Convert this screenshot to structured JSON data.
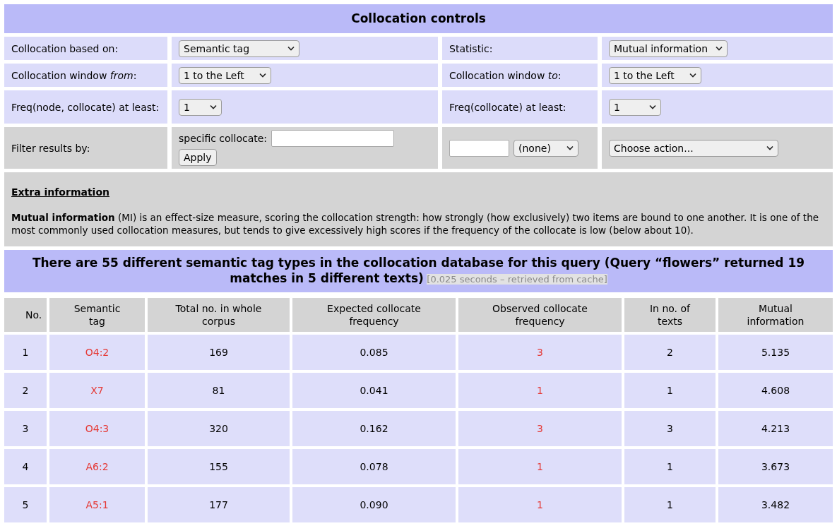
{
  "controls": {
    "title": "Collocation controls",
    "rows": [
      {
        "kind": "setting",
        "cells": [
          {
            "kind": "label",
            "text": "Collocation based on:"
          },
          {
            "kind": "select",
            "value": "Semantic tag"
          },
          {
            "kind": "label",
            "text": "Statistic:"
          },
          {
            "kind": "select",
            "value": "Mutual information"
          }
        ]
      },
      {
        "kind": "setting",
        "cells": [
          {
            "kind": "label",
            "text": "Collocation window *from*:"
          },
          {
            "kind": "select",
            "value": "1 to the Left"
          },
          {
            "kind": "label",
            "text": "Collocation window *to*:"
          },
          {
            "kind": "select",
            "value": "1 to the Left"
          }
        ]
      },
      {
        "kind": "setting",
        "cells": [
          {
            "kind": "label",
            "text": "Freq(node, collocate) at least:"
          },
          {
            "kind": "select",
            "value": "1"
          },
          {
            "kind": "label",
            "text": "Freq(collocate) at least:"
          },
          {
            "kind": "select",
            "value": "1"
          }
        ]
      },
      {
        "kind": "filter",
        "cells": [
          {
            "kind": "label",
            "text": "Filter results by:"
          },
          {
            "kind": "collocate",
            "label": "specific collocate:",
            "button": "Apply"
          },
          {
            "kind": "input_select",
            "value": "(none)"
          },
          {
            "kind": "select",
            "value": "Choose action..."
          }
        ]
      }
    ]
  },
  "extra": {
    "heading": "Extra information",
    "text": "**Mutual information** (MI) is an effect-size measure, scoring the collocation strength: how strongly (how exclusively) two items are bound to one another. It is one of the most commonly used collocation measures, but tends to give excessively high scores if the frequency of the collocate is low (below about 10)."
  },
  "results": {
    "title": "There are 55 different semantic tag types in the collocation database for this query (Query “flowers” returned 19 matches in 5 different texts)",
    "note": "[0.025 seconds – retrieved from cache]",
    "columns": [
      {
        "label": "No.",
        "kind": "plain"
      },
      {
        "label": "Semantic tag",
        "kind": "link"
      },
      {
        "label": "Total no. in whole corpus",
        "kind": "plain"
      },
      {
        "label": "Expected collocate frequency",
        "kind": "plain"
      },
      {
        "label": "Observed collocate frequency",
        "kind": "link"
      },
      {
        "label": "In no. of texts",
        "kind": "plain"
      },
      {
        "label": "Mutual information",
        "kind": "plain"
      }
    ],
    "rows": [
      [
        "1",
        "O4:2",
        "169",
        "0.085",
        "3",
        "2",
        "5.135"
      ],
      [
        "2",
        "X7",
        "81",
        "0.041",
        "1",
        "1",
        "4.608"
      ],
      [
        "3",
        "O4:3",
        "320",
        "0.162",
        "3",
        "3",
        "4.213"
      ],
      [
        "4",
        "A6:2",
        "155",
        "0.078",
        "1",
        "1",
        "3.673"
      ],
      [
        "5",
        "A5:1",
        "177",
        "0.090",
        "1",
        "1",
        "3.482"
      ]
    ]
  }
}
